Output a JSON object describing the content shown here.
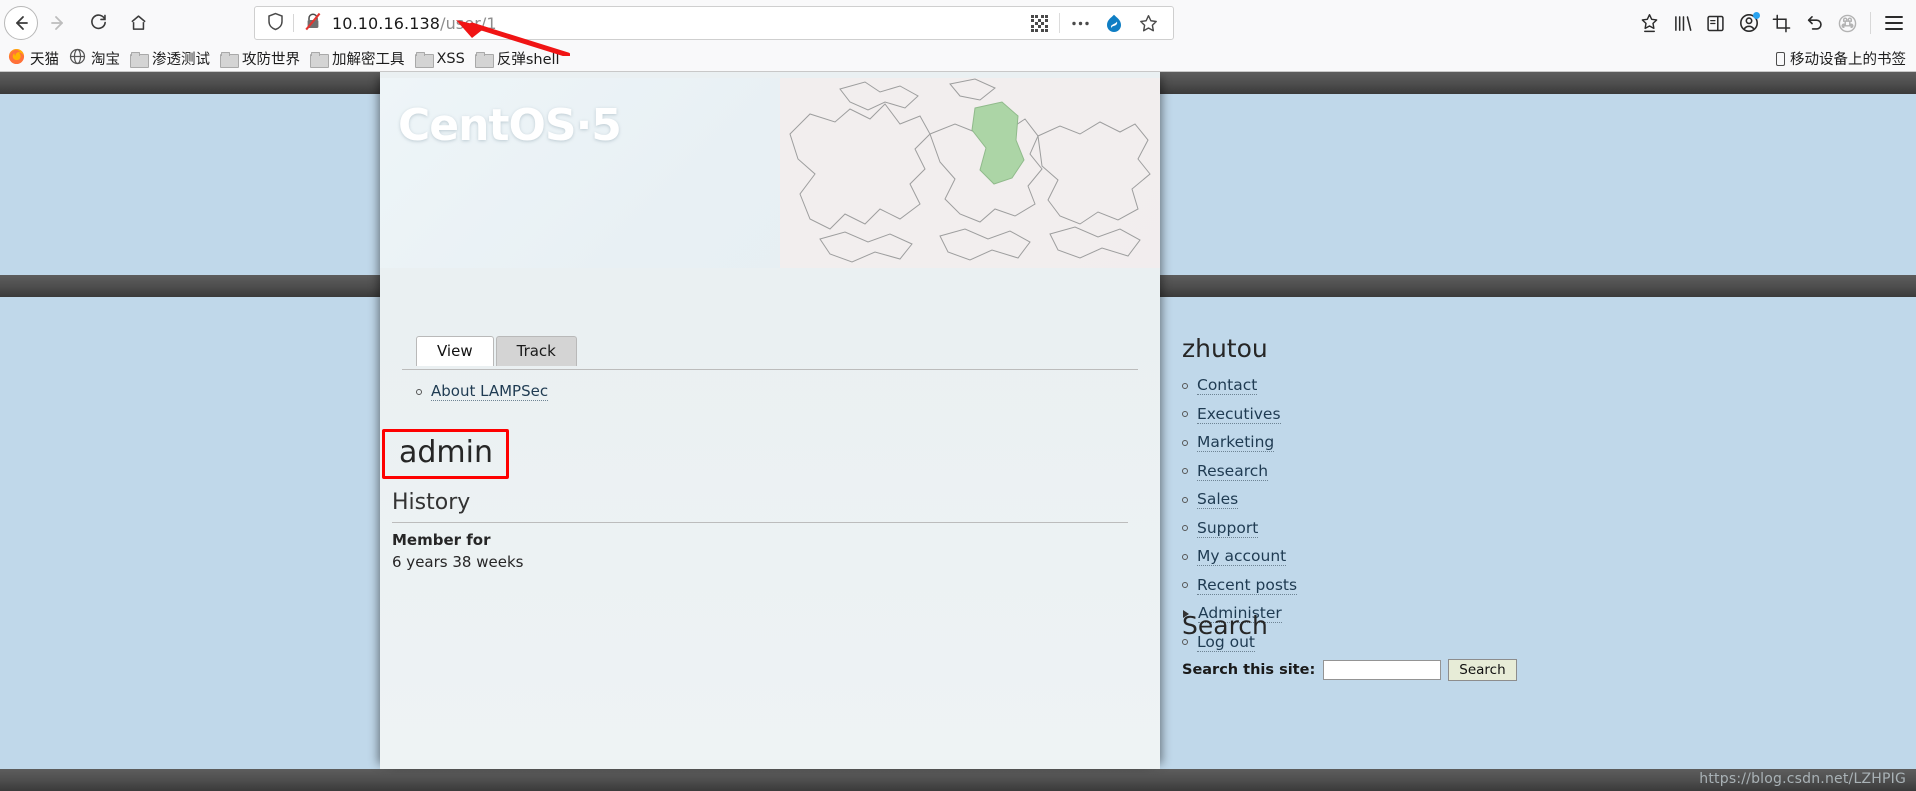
{
  "browser": {
    "nav": {
      "back": "back-button",
      "forward": "forward-button",
      "reload": "reload-button",
      "home": "home-button"
    },
    "url": {
      "host": "10.10.16.138",
      "path": "/user/1",
      "full": "10.10.16.138/user/1",
      "shield_icon": "shield-icon",
      "insecure_icon": "lock-slash-icon",
      "qr_icon": "qr-code-icon",
      "more_icon": "ellipsis-icon",
      "drupal_icon": "drupal-icon",
      "bookmark_star_icon": "star-icon"
    },
    "toolbar_icons": [
      "save-to-pocket-icon",
      "library-icon",
      "sidebar-icon",
      "account-icon",
      "screenshot-icon",
      "undo-icon",
      "command-icon",
      "hamburger-menu-icon"
    ],
    "bookmarks": [
      {
        "label": "天猫",
        "icon": "firefox-icon"
      },
      {
        "label": "淘宝",
        "icon": "globe-icon"
      },
      {
        "label": "渗透测试",
        "icon": "folder-icon"
      },
      {
        "label": "攻防世界",
        "icon": "folder-icon"
      },
      {
        "label": "加解密工具",
        "icon": "folder-icon"
      },
      {
        "label": "XSS",
        "icon": "folder-icon"
      },
      {
        "label": "反弹shell",
        "icon": "folder-icon"
      }
    ],
    "bookmarks_mobile": "移动设备上的书签"
  },
  "site": {
    "banner_logo": "CentOS·5",
    "tabs": [
      {
        "label": "View",
        "active": true
      },
      {
        "label": "Track",
        "active": false
      }
    ],
    "content_links": [
      {
        "label": "About LAMPSec"
      }
    ],
    "username": "admin",
    "history": {
      "heading": "History",
      "member_for_label": "Member for",
      "member_for_value": "6 years 38 weeks"
    }
  },
  "sidebar": {
    "title": "zhutou",
    "items": [
      {
        "label": "Contact",
        "bullet": "circle"
      },
      {
        "label": "Executives",
        "bullet": "circle"
      },
      {
        "label": "Marketing",
        "bullet": "circle"
      },
      {
        "label": "Research",
        "bullet": "circle"
      },
      {
        "label": "Sales",
        "bullet": "circle"
      },
      {
        "label": "Support",
        "bullet": "circle"
      },
      {
        "label": "My account",
        "bullet": "circle"
      },
      {
        "label": "Recent posts",
        "bullet": "circle"
      },
      {
        "label": "Administer",
        "bullet": "triangle"
      },
      {
        "label": "Log out",
        "bullet": "circle"
      }
    ],
    "search": {
      "heading": "Search",
      "label": "Search this site:",
      "value": "",
      "placeholder": "",
      "button": "Search"
    }
  },
  "annotations": {
    "highlight_color": "#fe0000",
    "watermark": "https://blog.csdn.net/LZHPIG"
  }
}
